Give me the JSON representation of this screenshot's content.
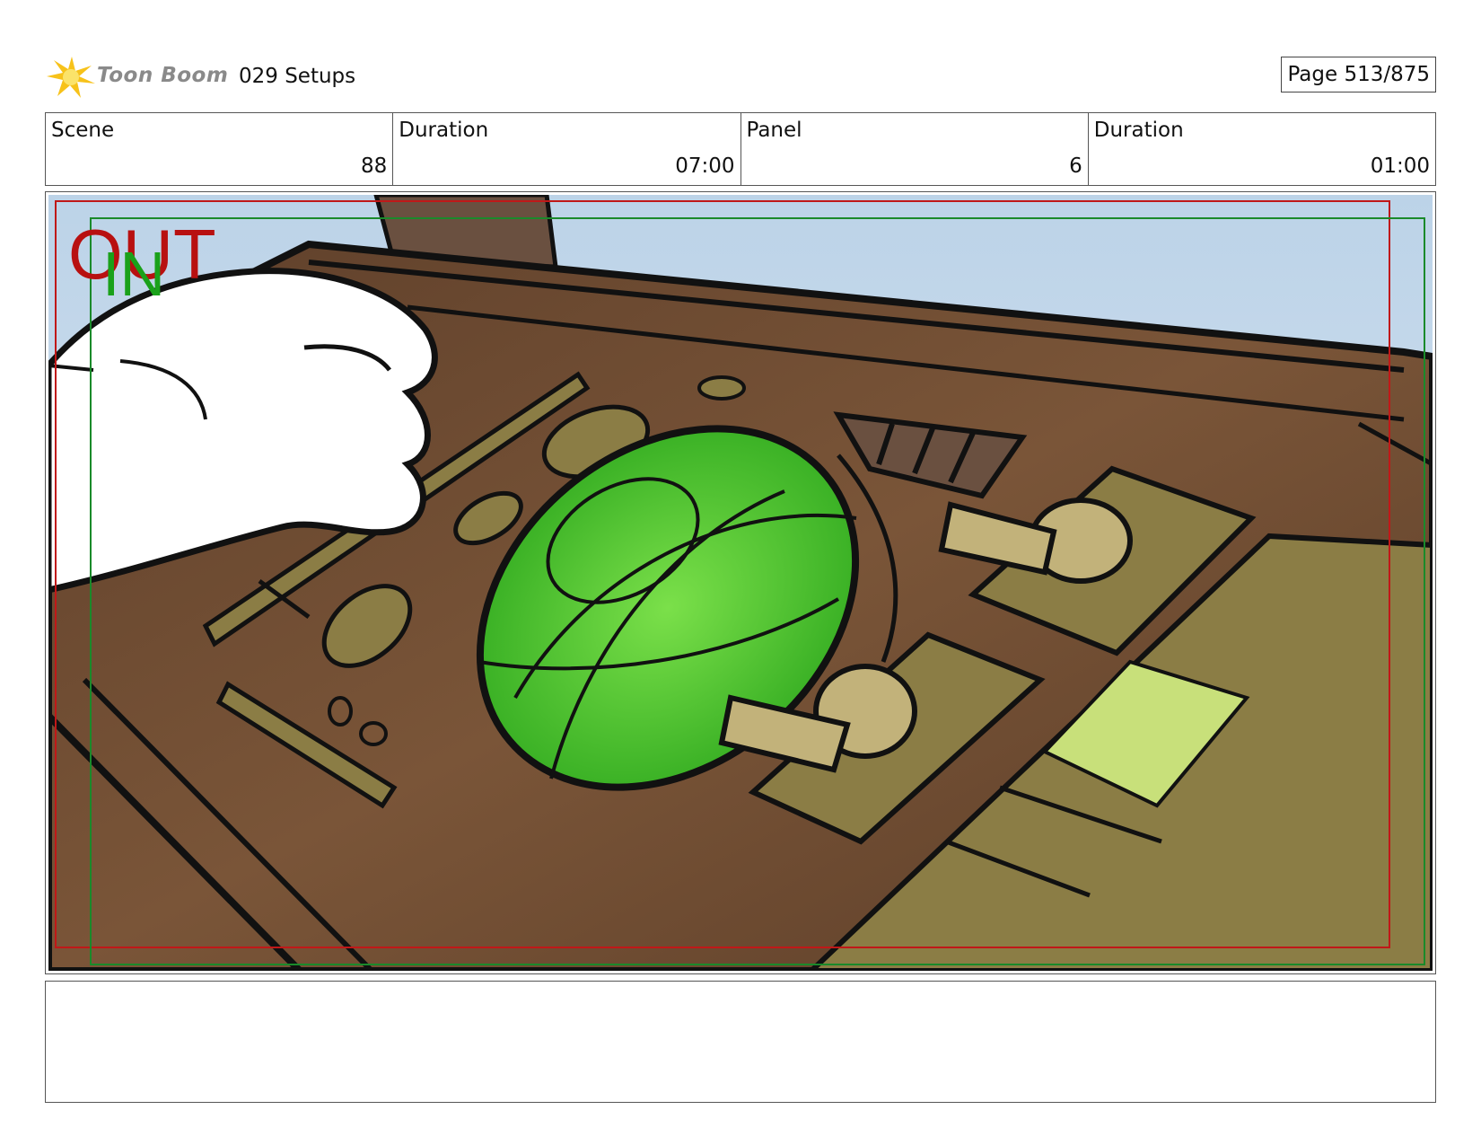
{
  "header": {
    "logo_text": "Toon Boom",
    "title": "029 Setups",
    "page_label": "Page 513/875"
  },
  "info": {
    "scene_label": "Scene",
    "scene_value": "88",
    "scene_duration_label": "Duration",
    "scene_duration_value": "07:00",
    "panel_label": "Panel",
    "panel_value": "6",
    "panel_duration_label": "Duration",
    "panel_duration_value": "01:00"
  },
  "panel": {
    "out_label": "OUT",
    "in_label": "IN"
  },
  "notes": {
    "text": ""
  },
  "colors": {
    "out_frame": "#c01818",
    "in_frame": "#1a8a2a",
    "wood": "#6b4a33",
    "screen_green": "#3fbf2a",
    "sky": "#c9dbea"
  }
}
